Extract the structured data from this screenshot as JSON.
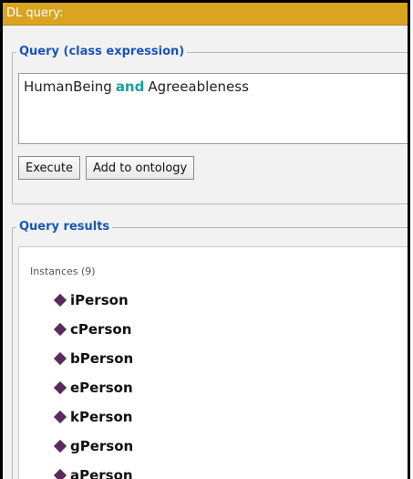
{
  "window": {
    "title": "DL query:"
  },
  "query": {
    "group_title": "Query (class expression)",
    "expression": {
      "part1": "HumanBeing",
      "keyword": "and",
      "part2": "Agreeableness"
    },
    "buttons": {
      "execute": "Execute",
      "add_to_ontology": "Add to ontology"
    }
  },
  "results": {
    "group_title": "Query results",
    "section_label": "Instances (9)",
    "items": [
      {
        "label": "iPerson",
        "icon": "individual-diamond-icon"
      },
      {
        "label": "cPerson",
        "icon": "individual-diamond-icon"
      },
      {
        "label": "bPerson",
        "icon": "individual-diamond-icon"
      },
      {
        "label": "ePerson",
        "icon": "individual-diamond-icon"
      },
      {
        "label": "kPerson",
        "icon": "individual-diamond-icon"
      },
      {
        "label": "gPerson",
        "icon": "individual-diamond-icon"
      },
      {
        "label": "aPerson",
        "icon": "individual-diamond-icon"
      }
    ]
  },
  "colors": {
    "titlebar": "#d9a420",
    "group_title": "#1a55b5",
    "keyword": "#1aa0a0",
    "diamond": "#5a2a5e"
  }
}
